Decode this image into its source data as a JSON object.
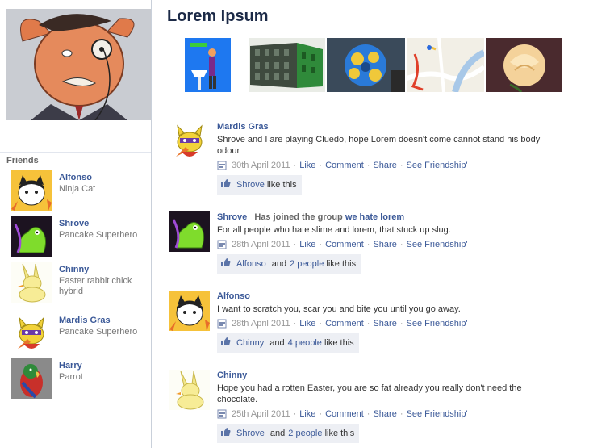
{
  "page": {
    "title": "Lorem Ipsum"
  },
  "friends": {
    "title": "Friends",
    "items": [
      {
        "name": "Alfonso",
        "desc": "Ninja Cat"
      },
      {
        "name": "Shrove",
        "desc": "Pancake Superhero"
      },
      {
        "name": "Chinny",
        "desc": "Easter rabbit chick hybrid"
      },
      {
        "name": "Mardis Gras",
        "desc": "Pancake Superhero"
      },
      {
        "name": "Harry",
        "desc": "Parrot"
      }
    ]
  },
  "posts": [
    {
      "author": "Mardis Gras",
      "action": "",
      "group": "",
      "message": "Shrove and I are playing Cluedo, hope Lorem doesn't come cannot stand his body odour",
      "date": "30th April 2011",
      "like": "Like",
      "comment": "Comment",
      "share": "Share",
      "friendship": "See Friendship'",
      "likers": "Shrove",
      "and": "",
      "others": "",
      "like_suffix": "like this"
    },
    {
      "author": "Shrove",
      "action": "Has joined the group",
      "group": "we hate lorem",
      "message": "For all people who hate slime and lorem, that stuck up slug.",
      "date": "28th April 2011",
      "like": "Like",
      "comment": "Comment",
      "share": "Share",
      "friendship": "See Friendship'",
      "likers": "Alfonso",
      "and": "and",
      "others": "2 people",
      "like_suffix": "like this"
    },
    {
      "author": "Alfonso",
      "action": "",
      "group": "",
      "message": "I want to scratch you, scar you and bite you until you go away.",
      "date": "28th April 2011",
      "like": "Like",
      "comment": "Comment",
      "share": "Share",
      "friendship": "See Friendship'",
      "likers": "Chinny",
      "and": "and",
      "others": "4 people",
      "like_suffix": "like this"
    },
    {
      "author": "Chinny",
      "action": "",
      "group": "",
      "message": "Hope you had a rotten Easter, you are so fat already you really don't need the chocolate.",
      "date": "25th April 2011",
      "like": "Like",
      "comment": "Comment",
      "share": "Share",
      "friendship": "See Friendship'",
      "likers": "Shrove",
      "and": "and",
      "others": "2 people",
      "like_suffix": "like this"
    }
  ],
  "colors": {
    "link": "#3b5998",
    "title": "#1c2a47",
    "likes_bg": "#edeff4",
    "border": "#c9d0da"
  },
  "icons": [
    "profile-picture",
    "cat-avatar",
    "slime-avatar",
    "bunny-avatar",
    "pancake-hero-avatar",
    "parrot-avatar",
    "post-type-icon",
    "thumbs-up-icon"
  ]
}
